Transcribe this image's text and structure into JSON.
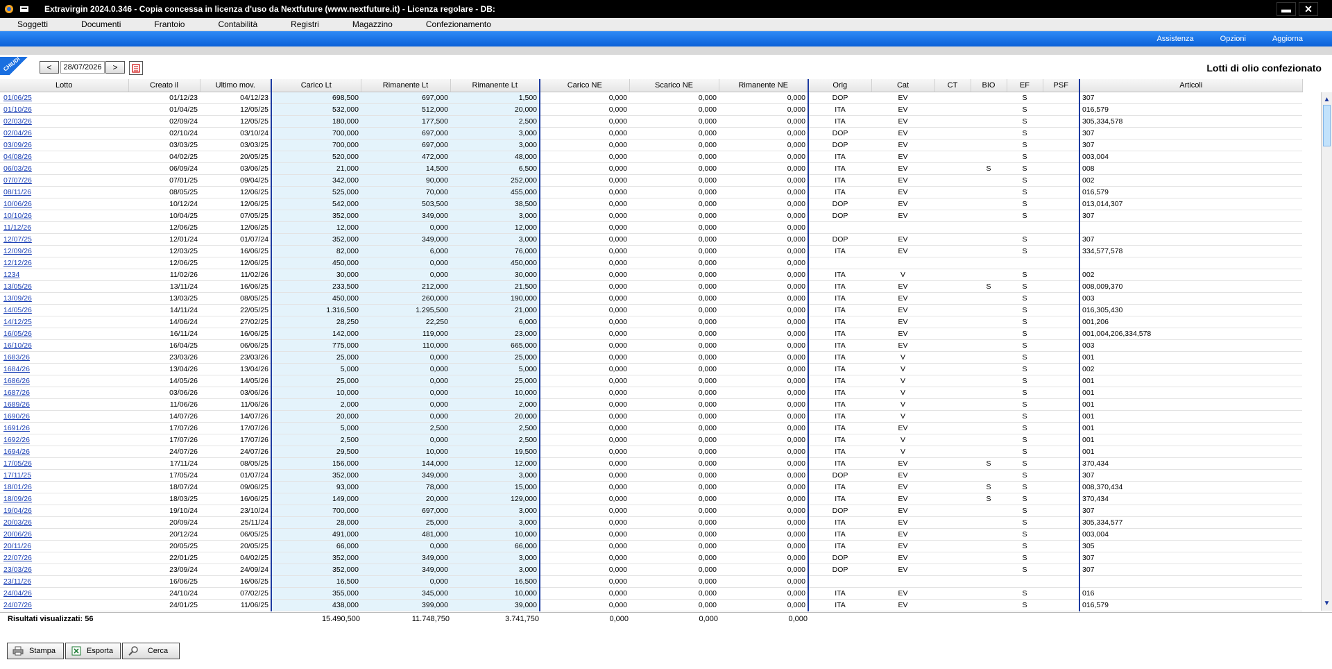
{
  "window": {
    "title": "Extravirgin 2024.0.346 - Copia concessa in licenza d'uso da Nextfuture (www.nextfuture.it) - Licenza regolare - DB:",
    "min_label": "▬",
    "close_label": "✕"
  },
  "menu": [
    "Soggetti",
    "Documenti",
    "Frantoio",
    "Contabilità",
    "Registri",
    "Magazzino",
    "Confezionamento"
  ],
  "toplinks": [
    "Assistenza",
    "Opzioni",
    "Aggiorna"
  ],
  "toolbar": {
    "chiudi_label": "CHIUDI",
    "prev_label": "<",
    "next_label": ">",
    "date_value": "28/07/2026",
    "page_title": "Lotti di olio confezionato"
  },
  "columns": [
    "Lotto",
    "Creato il",
    "Ultimo mov.",
    "Carico Lt",
    "Rimanente Lt",
    "Rimanente Lt",
    "Carico NE",
    "Scarico NE",
    "Rimanente NE",
    "Orig",
    "Cat",
    "CT",
    "BIO",
    "EF",
    "PSF",
    "Articoli"
  ],
  "rows": [
    [
      "01/06/25",
      "01/12/23",
      "04/12/23",
      "698,500",
      "697,000",
      "1,500",
      "0,000",
      "0,000",
      "0,000",
      "DOP",
      "EV",
      "",
      "",
      "S",
      "",
      "307"
    ],
    [
      "01/10/26",
      "01/04/25",
      "12/05/25",
      "532,000",
      "512,000",
      "20,000",
      "0,000",
      "0,000",
      "0,000",
      "ITA",
      "EV",
      "",
      "",
      "S",
      "",
      "016,579"
    ],
    [
      "02/03/26",
      "02/09/24",
      "12/05/25",
      "180,000",
      "177,500",
      "2,500",
      "0,000",
      "0,000",
      "0,000",
      "ITA",
      "EV",
      "",
      "",
      "S",
      "",
      "305,334,578"
    ],
    [
      "02/04/26",
      "02/10/24",
      "03/10/24",
      "700,000",
      "697,000",
      "3,000",
      "0,000",
      "0,000",
      "0,000",
      "DOP",
      "EV",
      "",
      "",
      "S",
      "",
      "307"
    ],
    [
      "03/09/26",
      "03/03/25",
      "03/03/25",
      "700,000",
      "697,000",
      "3,000",
      "0,000",
      "0,000",
      "0,000",
      "DOP",
      "EV",
      "",
      "",
      "S",
      "",
      "307"
    ],
    [
      "04/08/26",
      "04/02/25",
      "20/05/25",
      "520,000",
      "472,000",
      "48,000",
      "0,000",
      "0,000",
      "0,000",
      "ITA",
      "EV",
      "",
      "",
      "S",
      "",
      "003,004"
    ],
    [
      "06/03/26",
      "06/09/24",
      "03/06/25",
      "21,000",
      "14,500",
      "6,500",
      "0,000",
      "0,000",
      "0,000",
      "ITA",
      "EV",
      "",
      "S",
      "S",
      "",
      "008"
    ],
    [
      "07/07/26",
      "07/01/25",
      "09/04/25",
      "342,000",
      "90,000",
      "252,000",
      "0,000",
      "0,000",
      "0,000",
      "ITA",
      "EV",
      "",
      "",
      "S",
      "",
      "002"
    ],
    [
      "08/11/26",
      "08/05/25",
      "12/06/25",
      "525,000",
      "70,000",
      "455,000",
      "0,000",
      "0,000",
      "0,000",
      "ITA",
      "EV",
      "",
      "",
      "S",
      "",
      "016,579"
    ],
    [
      "10/06/26",
      "10/12/24",
      "12/06/25",
      "542,000",
      "503,500",
      "38,500",
      "0,000",
      "0,000",
      "0,000",
      "DOP",
      "EV",
      "",
      "",
      "S",
      "",
      "013,014,307"
    ],
    [
      "10/10/26",
      "10/04/25",
      "07/05/25",
      "352,000",
      "349,000",
      "3,000",
      "0,000",
      "0,000",
      "0,000",
      "DOP",
      "EV",
      "",
      "",
      "S",
      "",
      "307"
    ],
    [
      "11/12/26",
      "12/06/25",
      "12/06/25",
      "12,000",
      "0,000",
      "12,000",
      "0,000",
      "0,000",
      "0,000",
      "",
      "",
      "",
      "",
      "",
      "",
      ""
    ],
    [
      "12/07/25",
      "12/01/24",
      "01/07/24",
      "352,000",
      "349,000",
      "3,000",
      "0,000",
      "0,000",
      "0,000",
      "DOP",
      "EV",
      "",
      "",
      "S",
      "",
      "307"
    ],
    [
      "12/09/26",
      "12/03/25",
      "16/06/25",
      "82,000",
      "6,000",
      "76,000",
      "0,000",
      "0,000",
      "0,000",
      "ITA",
      "EV",
      "",
      "",
      "S",
      "",
      "334,577,578"
    ],
    [
      "12/12/26",
      "12/06/25",
      "12/06/25",
      "450,000",
      "0,000",
      "450,000",
      "0,000",
      "0,000",
      "0,000",
      "",
      "",
      "",
      "",
      "",
      "",
      ""
    ],
    [
      "1234",
      "11/02/26",
      "11/02/26",
      "30,000",
      "0,000",
      "30,000",
      "0,000",
      "0,000",
      "0,000",
      "ITA",
      "V",
      "",
      "",
      "S",
      "",
      "002"
    ],
    [
      "13/05/26",
      "13/11/24",
      "16/06/25",
      "233,500",
      "212,000",
      "21,500",
      "0,000",
      "0,000",
      "0,000",
      "ITA",
      "EV",
      "",
      "S",
      "S",
      "",
      "008,009,370"
    ],
    [
      "13/09/26",
      "13/03/25",
      "08/05/25",
      "450,000",
      "260,000",
      "190,000",
      "0,000",
      "0,000",
      "0,000",
      "ITA",
      "EV",
      "",
      "",
      "S",
      "",
      "003"
    ],
    [
      "14/05/26",
      "14/11/24",
      "22/05/25",
      "1.316,500",
      "1.295,500",
      "21,000",
      "0,000",
      "0,000",
      "0,000",
      "ITA",
      "EV",
      "",
      "",
      "S",
      "",
      "016,305,430"
    ],
    [
      "14/12/25",
      "14/06/24",
      "27/02/25",
      "28,250",
      "22,250",
      "6,000",
      "0,000",
      "0,000",
      "0,000",
      "ITA",
      "EV",
      "",
      "",
      "S",
      "",
      "001,206"
    ],
    [
      "16/05/26",
      "16/11/24",
      "16/06/25",
      "142,000",
      "119,000",
      "23,000",
      "0,000",
      "0,000",
      "0,000",
      "ITA",
      "EV",
      "",
      "",
      "S",
      "",
      "001,004,206,334,578"
    ],
    [
      "16/10/26",
      "16/04/25",
      "06/06/25",
      "775,000",
      "110,000",
      "665,000",
      "0,000",
      "0,000",
      "0,000",
      "ITA",
      "EV",
      "",
      "",
      "S",
      "",
      "003"
    ],
    [
      "1683/26",
      "23/03/26",
      "23/03/26",
      "25,000",
      "0,000",
      "25,000",
      "0,000",
      "0,000",
      "0,000",
      "ITA",
      "V",
      "",
      "",
      "S",
      "",
      "001"
    ],
    [
      "1684/26",
      "13/04/26",
      "13/04/26",
      "5,000",
      "0,000",
      "5,000",
      "0,000",
      "0,000",
      "0,000",
      "ITA",
      "V",
      "",
      "",
      "S",
      "",
      "002"
    ],
    [
      "1686/26",
      "14/05/26",
      "14/05/26",
      "25,000",
      "0,000",
      "25,000",
      "0,000",
      "0,000",
      "0,000",
      "ITA",
      "V",
      "",
      "",
      "S",
      "",
      "001"
    ],
    [
      "1687/26",
      "03/06/26",
      "03/06/26",
      "10,000",
      "0,000",
      "10,000",
      "0,000",
      "0,000",
      "0,000",
      "ITA",
      "V",
      "",
      "",
      "S",
      "",
      "001"
    ],
    [
      "1689/26",
      "11/06/26",
      "11/06/26",
      "2,000",
      "0,000",
      "2,000",
      "0,000",
      "0,000",
      "0,000",
      "ITA",
      "V",
      "",
      "",
      "S",
      "",
      "001"
    ],
    [
      "1690/26",
      "14/07/26",
      "14/07/26",
      "20,000",
      "0,000",
      "20,000",
      "0,000",
      "0,000",
      "0,000",
      "ITA",
      "V",
      "",
      "",
      "S",
      "",
      "001"
    ],
    [
      "1691/26",
      "17/07/26",
      "17/07/26",
      "5,000",
      "2,500",
      "2,500",
      "0,000",
      "0,000",
      "0,000",
      "ITA",
      "EV",
      "",
      "",
      "S",
      "",
      "001"
    ],
    [
      "1692/26",
      "17/07/26",
      "17/07/26",
      "2,500",
      "0,000",
      "2,500",
      "0,000",
      "0,000",
      "0,000",
      "ITA",
      "V",
      "",
      "",
      "S",
      "",
      "001"
    ],
    [
      "1694/26",
      "24/07/26",
      "24/07/26",
      "29,500",
      "10,000",
      "19,500",
      "0,000",
      "0,000",
      "0,000",
      "ITA",
      "V",
      "",
      "",
      "S",
      "",
      "001"
    ],
    [
      "17/05/26",
      "17/11/24",
      "08/05/25",
      "156,000",
      "144,000",
      "12,000",
      "0,000",
      "0,000",
      "0,000",
      "ITA",
      "EV",
      "",
      "S",
      "S",
      "",
      "370,434"
    ],
    [
      "17/11/25",
      "17/05/24",
      "01/07/24",
      "352,000",
      "349,000",
      "3,000",
      "0,000",
      "0,000",
      "0,000",
      "DOP",
      "EV",
      "",
      "",
      "S",
      "",
      "307"
    ],
    [
      "18/01/26",
      "18/07/24",
      "09/06/25",
      "93,000",
      "78,000",
      "15,000",
      "0,000",
      "0,000",
      "0,000",
      "ITA",
      "EV",
      "",
      "S",
      "S",
      "",
      "008,370,434"
    ],
    [
      "18/09/26",
      "18/03/25",
      "16/06/25",
      "149,000",
      "20,000",
      "129,000",
      "0,000",
      "0,000",
      "0,000",
      "ITA",
      "EV",
      "",
      "S",
      "S",
      "",
      "370,434"
    ],
    [
      "19/04/26",
      "19/10/24",
      "23/10/24",
      "700,000",
      "697,000",
      "3,000",
      "0,000",
      "0,000",
      "0,000",
      "DOP",
      "EV",
      "",
      "",
      "S",
      "",
      "307"
    ],
    [
      "20/03/26",
      "20/09/24",
      "25/11/24",
      "28,000",
      "25,000",
      "3,000",
      "0,000",
      "0,000",
      "0,000",
      "ITA",
      "EV",
      "",
      "",
      "S",
      "",
      "305,334,577"
    ],
    [
      "20/06/26",
      "20/12/24",
      "06/05/25",
      "491,000",
      "481,000",
      "10,000",
      "0,000",
      "0,000",
      "0,000",
      "ITA",
      "EV",
      "",
      "",
      "S",
      "",
      "003,004"
    ],
    [
      "20/11/26",
      "20/05/25",
      "20/05/25",
      "66,000",
      "0,000",
      "66,000",
      "0,000",
      "0,000",
      "0,000",
      "ITA",
      "EV",
      "",
      "",
      "S",
      "",
      "305"
    ],
    [
      "22/07/26",
      "22/01/25",
      "04/02/25",
      "352,000",
      "349,000",
      "3,000",
      "0,000",
      "0,000",
      "0,000",
      "DOP",
      "EV",
      "",
      "",
      "S",
      "",
      "307"
    ],
    [
      "23/03/26",
      "23/09/24",
      "24/09/24",
      "352,000",
      "349,000",
      "3,000",
      "0,000",
      "0,000",
      "0,000",
      "DOP",
      "EV",
      "",
      "",
      "S",
      "",
      "307"
    ],
    [
      "23/11/26",
      "16/06/25",
      "16/06/25",
      "16,500",
      "0,000",
      "16,500",
      "0,000",
      "0,000",
      "0,000",
      "",
      "",
      "",
      "",
      "",
      "",
      ""
    ],
    [
      "24/04/26",
      "24/10/24",
      "07/02/25",
      "355,000",
      "345,000",
      "10,000",
      "0,000",
      "0,000",
      "0,000",
      "ITA",
      "EV",
      "",
      "",
      "S",
      "",
      "016"
    ],
    [
      "24/07/26",
      "24/01/25",
      "11/06/25",
      "438,000",
      "399,000",
      "39,000",
      "0,000",
      "0,000",
      "0,000",
      "ITA",
      "EV",
      "",
      "",
      "S",
      "",
      "016,579"
    ]
  ],
  "footer": {
    "results_label": "Risultati visualizzati: 56",
    "totals": [
      "15.490,500",
      "11.748,750",
      "3.741,750",
      "0,000",
      "0,000",
      "0,000"
    ]
  },
  "buttons": {
    "stampa": "Stampa",
    "esporta": "Esporta",
    "cerca": "Cerca"
  }
}
